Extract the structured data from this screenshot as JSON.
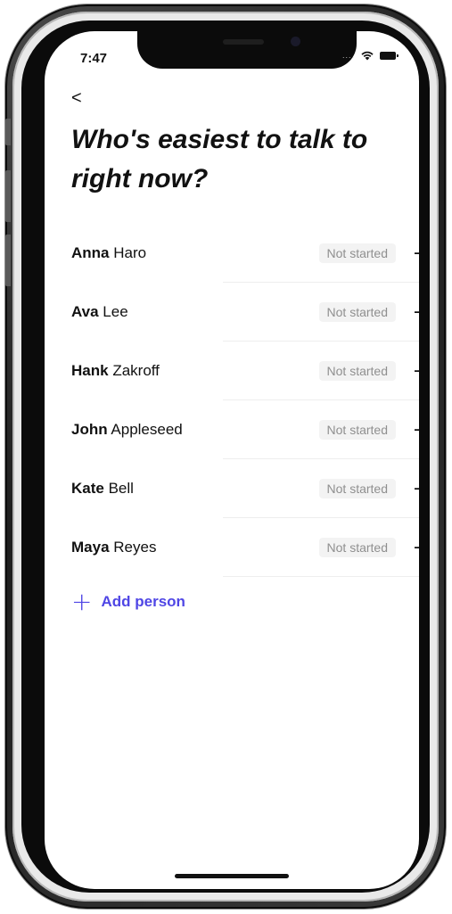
{
  "status_bar": {
    "time": "7:47",
    "signal": "....",
    "wifi_icon": "wifi-icon",
    "battery_icon": "battery-icon"
  },
  "nav": {
    "back_label": "<"
  },
  "page": {
    "title": "Who's easiest to talk to right now?"
  },
  "people": [
    {
      "first": "Anna",
      "last": "Haro",
      "status": "Not started"
    },
    {
      "first": "Ava",
      "last": "Lee",
      "status": "Not started"
    },
    {
      "first": "Hank",
      "last": "Zakroff",
      "status": "Not started"
    },
    {
      "first": "John",
      "last": "Appleseed",
      "status": "Not started"
    },
    {
      "first": "Kate",
      "last": "Bell",
      "status": "Not started"
    },
    {
      "first": "Maya",
      "last": "Reyes",
      "status": "Not started"
    }
  ],
  "actions": {
    "add_person_label": "Add person",
    "add_icon": "+",
    "arrow_icon": "→"
  },
  "colors": {
    "accent": "#4f46e5",
    "text": "#111111",
    "badge_bg": "#f3f3f3",
    "badge_text": "#8f8f8f"
  }
}
